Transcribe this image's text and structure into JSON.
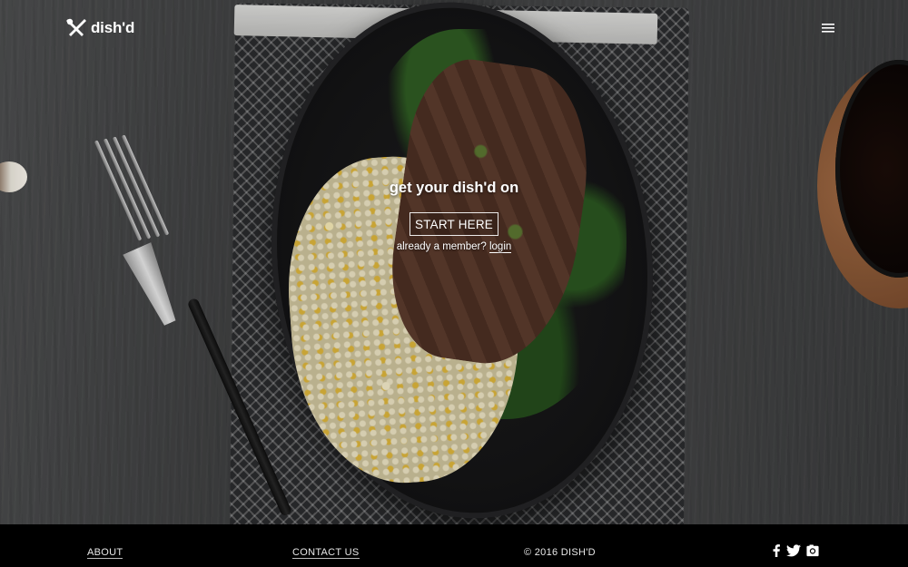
{
  "header": {
    "logo_text": "dish'd",
    "logo_icon": "fork-knife-icon",
    "menu_icon": "hamburger-menu-icon"
  },
  "hero": {
    "headline": "get your dish'd on",
    "cta_label": "START HERE",
    "member_prefix": "already a member? ",
    "login_label": "login"
  },
  "footer": {
    "about_label": "ABOUT",
    "contact_label": "CONTACT US",
    "copyright": "© 2016 DISH'D",
    "social_icons": [
      "facebook-icon",
      "twitter-icon",
      "instagram-icon"
    ]
  },
  "colors": {
    "background": "#3f4041",
    "footer": "#000000",
    "text": "#ffffff"
  }
}
